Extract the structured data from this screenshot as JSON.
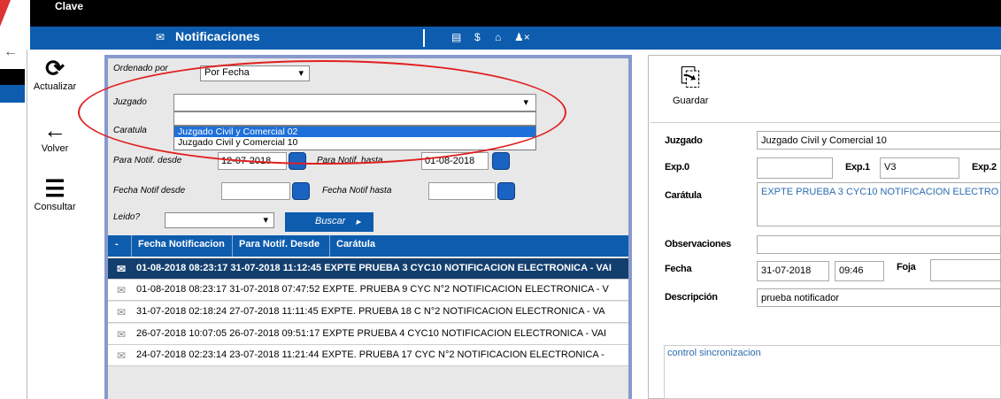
{
  "top": {
    "app_label": "Clave",
    "title": "Notificaciones",
    "toolbar_icons": [
      "document-icon",
      "dollar-icon",
      "home-icon",
      "user-remove-icon"
    ]
  },
  "side_toolbar": {
    "refresh": "Actualizar",
    "back": "Volver",
    "query": "Consultar"
  },
  "filters": {
    "order_label": "Ordenado por",
    "order_value": "Por Fecha",
    "court_label": "Juzgado",
    "court_value": "",
    "court_options": [
      "Juzgado Civil y Comercial 02",
      "Juzgado Civil y Comercial 10"
    ],
    "caratula_label": "Caratula",
    "from_label": "Para Notif. desde",
    "from_value": "12-07-2018",
    "to_label": "Para Notif. hasta",
    "to_value": "01-08-2018",
    "notif_from_label": "Fecha Notif desde",
    "notif_from_value": "",
    "notif_to_label": "Fecha Notif hasta",
    "notif_to_value": "",
    "read_label": "Leido?",
    "read_value": "",
    "search_label": "Buscar"
  },
  "table": {
    "headers": [
      "-",
      "Fecha Notificacion",
      "Para Notif. Desde",
      "Carátula"
    ],
    "rows": [
      "01-08-2018 08:23:17  31-07-2018 11:12:45  EXPTE PRUEBA 3 CYC10 NOTIFICACION ELECTRONICA - VAI",
      "01-08-2018 08:23:17  31-07-2018 07:47:52  EXPTE. PRUEBA 9 CYC N°2 NOTIFICACION ELECTRONICA - V",
      "31-07-2018 02:18:24  27-07-2018 11:11:45  EXPTE. PRUEBA 18 C N°2 NOTIFICACION ELECTRONICA - VA",
      "26-07-2018 10:07:05  26-07-2018 09:51:17  EXPTE PRUEBA 4 CYC10 NOTIFICACION ELECTRONICA - VAI",
      "24-07-2018 02:23:14  23-07-2018 11:21:44  EXPTE. PRUEBA 17 CYC N°2 NOTIFICACION ELECTRONICA -"
    ]
  },
  "detail": {
    "save_label": "Guardar",
    "court_label": "Juzgado",
    "court_value": "Juzgado Civil y Comercial 10",
    "exp0_label": "Exp.0",
    "exp0_value": "",
    "exp1_label": "Exp.1",
    "exp1_value": "V3",
    "exp2_label": "Exp.2",
    "caratula_label": "Carátula",
    "caratula_value": "EXPTE PRUEBA 3 CYC10 NOTIFICACION ELECTRO",
    "obs_label": "Observaciones",
    "obs_value": "",
    "date_label": "Fecha",
    "date_value": "31-07-2018",
    "time_value": "09:46",
    "foja_label": "Foja",
    "foja_value": "",
    "desc_label": "Descripción",
    "desc_value": "prueba notificador",
    "control_text": "control sincronizacion"
  },
  "colors": {
    "brand_blue": "#0d5cae",
    "selected_row": "#123f6e",
    "annotation_red": "#e02020"
  }
}
